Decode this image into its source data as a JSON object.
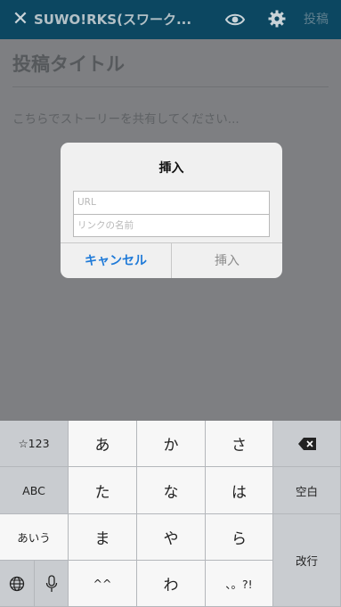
{
  "topbar": {
    "title": "SUWO!RKS(スワーク...",
    "post_label": "投稿",
    "icons": [
      "close-icon",
      "eye-icon",
      "gear-icon"
    ]
  },
  "editor": {
    "title_placeholder": "投稿タイトル",
    "body_placeholder": "こちらでストーリーを共有してください..."
  },
  "dialog": {
    "title": "挿入",
    "url_placeholder": "URL",
    "name_placeholder": "リンクの名前",
    "cancel_label": "キャンセル",
    "insert_label": "挿入"
  },
  "keyboard": {
    "left": [
      "☆123",
      "ABC",
      "あいう"
    ],
    "keys": [
      "あ",
      "か",
      "さ",
      "た",
      "な",
      "は",
      "ま",
      "や",
      "ら",
      "^^",
      "わ",
      "、。?!"
    ],
    "space_label": "空白",
    "return_label": "改行",
    "icons": [
      "backspace-icon",
      "globe-icon",
      "microphone-icon"
    ]
  }
}
